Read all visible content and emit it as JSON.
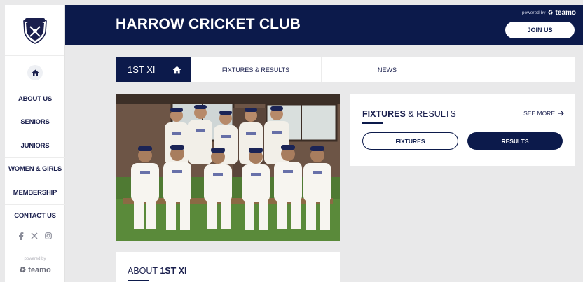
{
  "header": {
    "club_title": "HARROW CRICKET CLUB",
    "powered_by": "powered by",
    "brand": "teamo",
    "join_label": "JOIN US"
  },
  "sidebar": {
    "items": [
      {
        "label": "ABOUT US"
      },
      {
        "label": "SENIORS"
      },
      {
        "label": "JUNIORS"
      },
      {
        "label": "WOMEN & GIRLS"
      },
      {
        "label": "MEMBERSHIP"
      },
      {
        "label": "CONTACT US"
      }
    ],
    "powered_by": "powered by",
    "brand": "teamo",
    "social_icons": [
      "facebook-icon",
      "x-icon",
      "instagram-icon"
    ]
  },
  "tabs": {
    "active": "1ST XI",
    "items": [
      {
        "label": "FIXTURES & RESULTS"
      },
      {
        "label": "NEWS"
      }
    ]
  },
  "fixtures_card": {
    "title_bold": "FIXTURES",
    "title_rest": " & RESULTS",
    "see_more": "SEE MORE",
    "buttons": [
      "FIXTURES",
      "RESULTS"
    ]
  },
  "about_card": {
    "title_prefix": "ABOUT ",
    "title_bold": "1ST XI"
  },
  "colors": {
    "navy": "#0c1a4b",
    "background": "#e9e9ea",
    "grass": "#4f7a33"
  }
}
